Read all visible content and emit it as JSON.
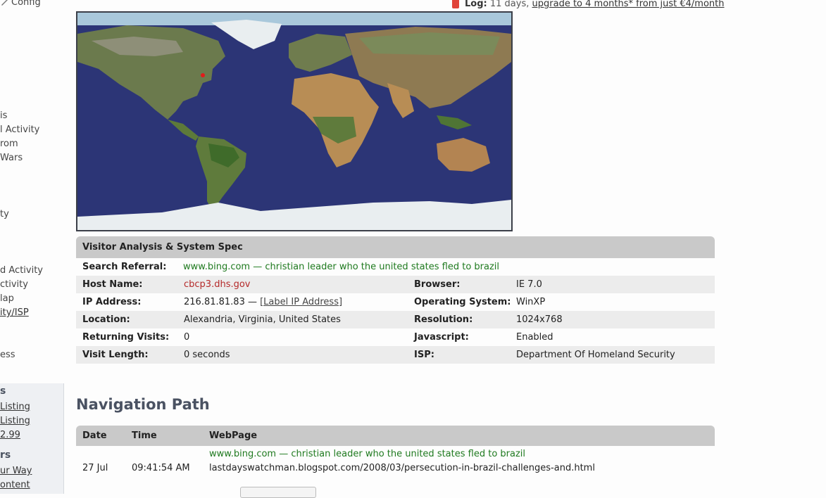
{
  "sidebar": {
    "config_label": "Config",
    "items": [
      "is",
      "l Activity",
      "rom",
      "Wars",
      "ty",
      "d Activity",
      "ctivity",
      "lap",
      "ity/ISP",
      "ess"
    ],
    "box_head_1": "s",
    "box_links_1": [
      "Listing",
      "Listing",
      "2.99"
    ],
    "box_head_2": "rs",
    "box_links_2": [
      "ur Way",
      "ontent"
    ]
  },
  "logbar": {
    "label": "Log:",
    "days": "11 days,",
    "upgrade": "upgrade to 4 months* from just €4/month"
  },
  "map": {
    "marker_color": "#e21b1b"
  },
  "visitor": {
    "title": "Visitor Analysis & System Spec",
    "search_referral_label": "Search Referral:",
    "search_referral_value": "www.bing.com — christian leader who the united states fled to brazil",
    "host_label": "Host Name:",
    "host_value": "cbcp3.dhs.gov",
    "browser_label": "Browser:",
    "browser_value": "IE 7.0",
    "ip_label": "IP Address:",
    "ip_value": "216.81.81.83 —",
    "ip_link": "[Label IP Address]",
    "os_label": "Operating System:",
    "os_value": "WinXP",
    "location_label": "Location:",
    "location_value": "Alexandria, Virginia, United States",
    "resolution_label": "Resolution:",
    "resolution_value": "1024x768",
    "returning_label": "Returning Visits:",
    "returning_value": "0",
    "js_label": "Javascript:",
    "js_value": "Enabled",
    "visit_length_label": "Visit Length:",
    "visit_length_value": "0 seconds",
    "isp_label": "ISP:",
    "isp_value": "Department Of Homeland Security"
  },
  "nav": {
    "title": "Navigation Path",
    "col_date": "Date",
    "col_time": "Time",
    "col_page": "WebPage",
    "rows": [
      {
        "date": "27 Jul",
        "time": "09:41:54 AM",
        "referrer": "www.bing.com — christian leader who the united states fled to brazil",
        "page": "lastdayswatchman.blogspot.com/2008/03/persecution-in-brazil-challenges-and.html"
      }
    ]
  }
}
